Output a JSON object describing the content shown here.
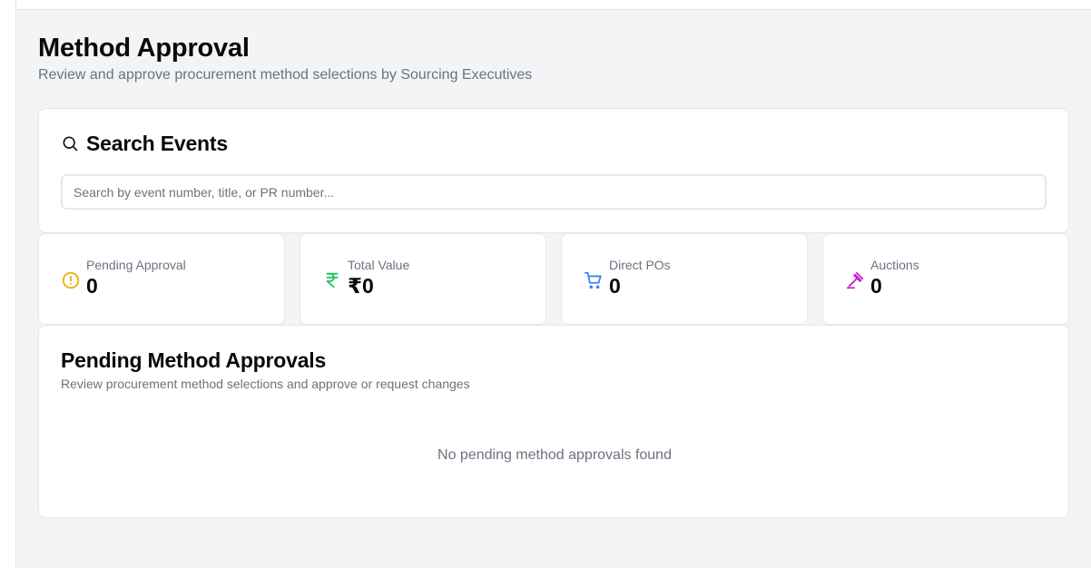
{
  "header": {
    "title": "Method Approval",
    "subtitle": "Review and approve procurement method selections by Sourcing Executives"
  },
  "search": {
    "title": "Search Events",
    "placeholder": "Search by event number, title, or PR number..."
  },
  "stats": [
    {
      "label": "Pending Approval",
      "value": "0",
      "icon": "alert-circle-icon",
      "color": "#eab308"
    },
    {
      "label": "Total Value",
      "value": "₹0",
      "icon": "rupee-icon",
      "color": "#22c55e"
    },
    {
      "label": "Direct POs",
      "value": "0",
      "icon": "cart-icon",
      "color": "#3b82f6"
    },
    {
      "label": "Auctions",
      "value": "0",
      "icon": "gavel-icon",
      "color": "#c026d3"
    }
  ],
  "approvals": {
    "title": "Pending Method Approvals",
    "subtitle": "Review procurement method selections and approve or request changes",
    "empty_message": "No pending method approvals found"
  }
}
